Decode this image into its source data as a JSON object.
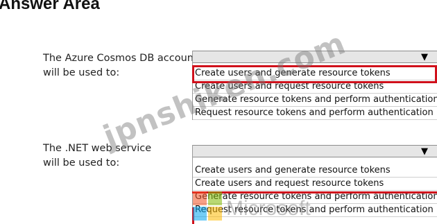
{
  "header": {
    "title": "Answer Area"
  },
  "questions": [
    {
      "line1": "The Azure Cosmos DB account",
      "line2": "will be used to:",
      "options": [
        "Create users and generate resource tokens",
        "Create users and request resource tokens",
        "Generate resource tokens and perform authentication",
        "Request resource tokens and perform authentication"
      ],
      "selected_index": 0
    },
    {
      "line1": "The .NET web service",
      "line2": "will be used to:",
      "options": [
        "Create users and generate resource tokens",
        "Create users and request resource tokens",
        "Generate resource tokens and perform authentication",
        "Request resource tokens and perform authentication"
      ],
      "selected_index": 3
    }
  ],
  "watermarks": {
    "site": "jpnshiken.com",
    "brand": "Microsoft"
  },
  "colors": {
    "selection_border": "#d0101b",
    "dropdown_header": "#e6e6e6"
  },
  "icons": {
    "dropdown": "triangle-down-icon",
    "logo": "microsoft-logo"
  }
}
